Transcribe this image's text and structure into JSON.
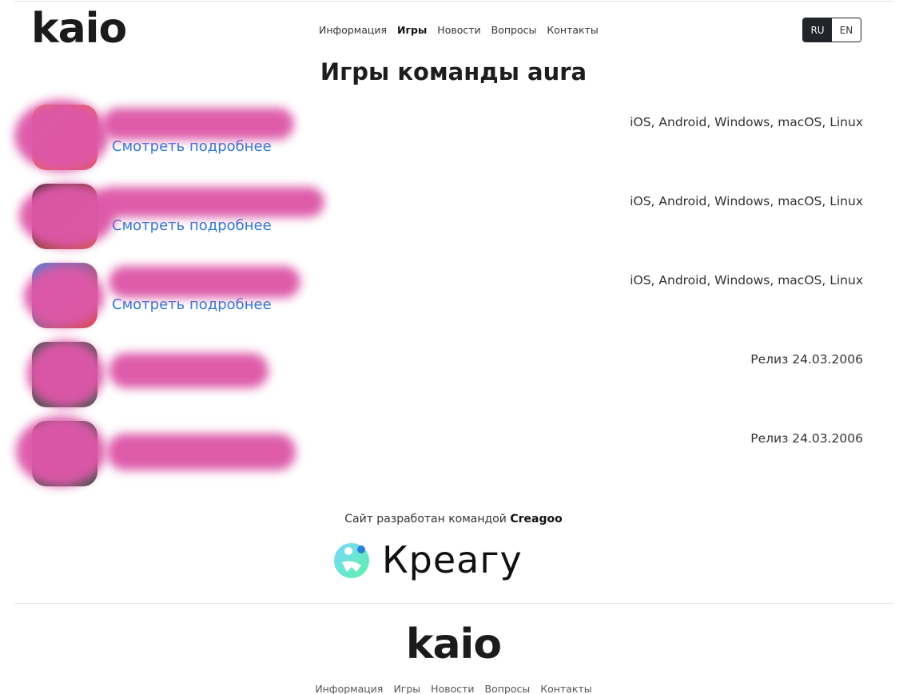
{
  "brand": {
    "logo": "kaio"
  },
  "nav": {
    "items": [
      "Информация",
      "Игры",
      "Новости",
      "Вопросы",
      "Контакты"
    ],
    "active": "Игры"
  },
  "lang": {
    "ru": "RU",
    "en": "EN",
    "selected": "RU"
  },
  "page_title": "Игры команды aura",
  "games": [
    {
      "name": "",
      "more": "Смотреть подробнее",
      "platforms": "iOS, Android, Windows, macOS, Linux"
    },
    {
      "name": "",
      "more": "Смотреть подробнее",
      "platforms": "iOS, Android, Windows, macOS, Linux"
    },
    {
      "name": "",
      "more": "Смотреть подробнее",
      "platforms": "iOS, Android, Windows, macOS, Linux"
    },
    {
      "name": "",
      "more": "",
      "platforms": "Релиз 24.03.2006"
    },
    {
      "name": "",
      "more": "",
      "platforms": "Релиз 24.03.2006"
    }
  ],
  "credits": {
    "text": "Сайт разработан командой",
    "team": "Creagoo",
    "wordmark": "Креагу"
  },
  "footer": {
    "logo": "kaio",
    "nav": [
      "Информация",
      "Игры",
      "Новости",
      "Вопросы",
      "Контакты"
    ]
  },
  "colors": {
    "link": "#2f79d4",
    "redaction": "#dd57a8",
    "lang_active_bg": "#212529"
  }
}
